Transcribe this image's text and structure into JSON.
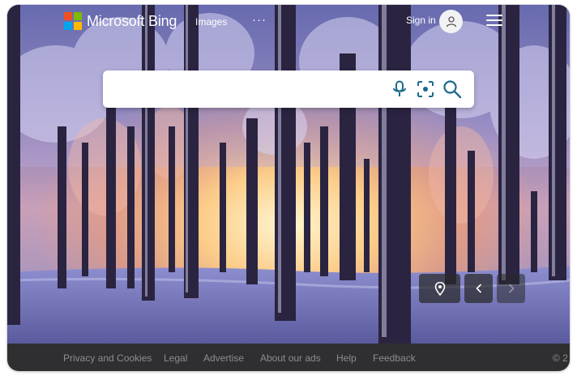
{
  "header": {
    "brand": "Microsoft Bing",
    "nav_images": "Images",
    "more": "···",
    "signin": "Sign in"
  },
  "brand_colors": [
    "#f25022",
    "#7fba00",
    "#00a4ef",
    "#ffb900"
  ],
  "search": {
    "value": "",
    "icons": [
      "microphone-icon",
      "visual-search-icon",
      "search-icon"
    ],
    "accent": "#1a6a8a"
  },
  "image_controls": {
    "icons": [
      "location-pin-icon",
      "chevron-left-icon",
      "chevron-right-icon"
    ]
  },
  "footer": {
    "links": [
      "Privacy and Cookies",
      "Legal",
      "Advertise",
      "About our ads",
      "Help",
      "Feedback"
    ],
    "copyright": "© 2"
  }
}
